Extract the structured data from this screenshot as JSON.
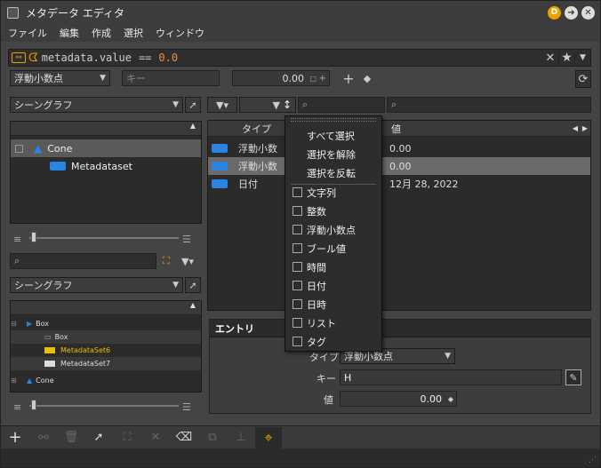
{
  "title": "メタデータ エディタ",
  "menu": [
    "ファイル",
    "編集",
    "作成",
    "選択",
    "ウィンドウ"
  ],
  "expression": {
    "label": "metadata.value",
    "op": "==",
    "value": "0.0"
  },
  "filterbar": {
    "type": "浮動小数点",
    "key_placeholder": "キー",
    "value": "0.00"
  },
  "top_left": {
    "dropdown": "シーングラフ",
    "tree": [
      {
        "label": "Cone"
      },
      {
        "label": "Metadataset"
      }
    ]
  },
  "table": {
    "headers": [
      "タイプ",
      "値"
    ],
    "rows": [
      {
        "type": "浮動小数",
        "value": "0.00"
      },
      {
        "type": "浮動小数",
        "value": "0.00"
      },
      {
        "type": "日付",
        "value": "12月 28, 2022"
      }
    ]
  },
  "bottom_left": {
    "dropdown": "シーングラフ",
    "tree": [
      "Box",
      "Box",
      "MetadataSet6",
      "MetadataSet7",
      "Cone"
    ]
  },
  "filter_menu": {
    "actions": [
      "すべて選択",
      "選択を解除",
      "選択を反転"
    ],
    "types": [
      "文字列",
      "整数",
      "浮動小数点",
      "ブール値",
      "時間",
      "日付",
      "日時",
      "リスト",
      "タグ"
    ]
  },
  "entry": {
    "title": "エントリ",
    "type_label": "タイプ",
    "type_value": "浮動小数点",
    "key_label": "キー",
    "key_value": "H",
    "value_label": "値",
    "value_value": "0.00"
  },
  "colors": {
    "accent": "#2a85e0",
    "highlight": "#f0a000",
    "badge": "#e8a300"
  }
}
